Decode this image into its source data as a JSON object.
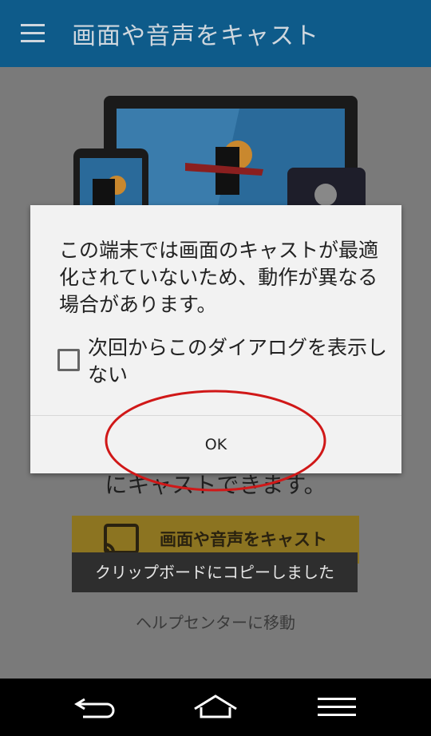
{
  "app_bar": {
    "title": "画面や音声をキャスト",
    "menu_icon": "hamburger-menu-icon"
  },
  "background": {
    "visible_text": "にキャストできます。",
    "cast_button_label": "画面や音声をキャスト",
    "help_link": "ヘルプセンターに移動"
  },
  "dialog": {
    "message": "この端末では画面のキャストが最適化されていないため、動作が異なる場合があります。",
    "checkbox_label": "次回からこのダイアログを表示しない",
    "checkbox_checked": false,
    "ok_label": "OK"
  },
  "toast": {
    "text": "クリップボードにコピーしました"
  },
  "nav_bar": {
    "back_icon": "back-icon",
    "home_icon": "home-icon",
    "menu_icon": "recent-menu-icon"
  },
  "colors": {
    "app_bar": "#0e5b8a",
    "cast_button": "#8c7421",
    "annotation_circle": "#d01818"
  }
}
